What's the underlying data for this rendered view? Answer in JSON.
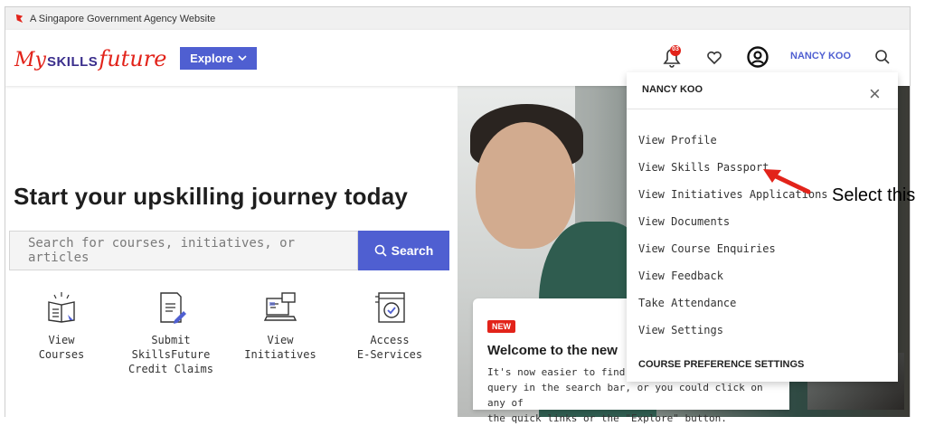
{
  "gov_banner": {
    "text": "A Singapore Government Agency Website"
  },
  "logo": {
    "my": "My",
    "skills": "SKILLS",
    "future": "future"
  },
  "header": {
    "explore_label": "Explore",
    "notification_count": "03",
    "username": "NANCY KOO"
  },
  "hero": {
    "title": "Start your upskilling journey today",
    "search_placeholder": "Search for courses, initiatives, or articles",
    "search_button": "Search"
  },
  "quick_links": [
    {
      "line1": "View",
      "line2": "Courses",
      "line3": "",
      "icon": "book-icon"
    },
    {
      "line1": "Submit",
      "line2": "SkillsFuture",
      "line3": "Credit Claims",
      "icon": "document-pen-icon"
    },
    {
      "line1": "View",
      "line2": "Initiatives",
      "line3": "",
      "icon": "computer-icon"
    },
    {
      "line1": "Access",
      "line2": "E-Services",
      "line3": "",
      "icon": "appliance-icon"
    }
  ],
  "promo": {
    "badge": "NEW",
    "title": "Welcome to the new",
    "text_line1": "It's now easier to find wha",
    "text_line2": "query in the search bar, or you could click on any of",
    "text_line3": "the quick links or the \"Explore\" button."
  },
  "dropdown": {
    "name": "NANCY KOO",
    "items": [
      "View Profile",
      "View Skills Passport",
      "View Initiatives Applications",
      "View Documents",
      "View Course Enquiries",
      "View Feedback",
      "Take Attendance",
      "View Settings"
    ],
    "section_title": "COURSE PREFERENCE SETTINGS"
  },
  "annotation": {
    "text": "Select this",
    "color": "#e2231a"
  },
  "colors": {
    "accent": "#4f5fd1",
    "brand_red": "#e2231a"
  }
}
